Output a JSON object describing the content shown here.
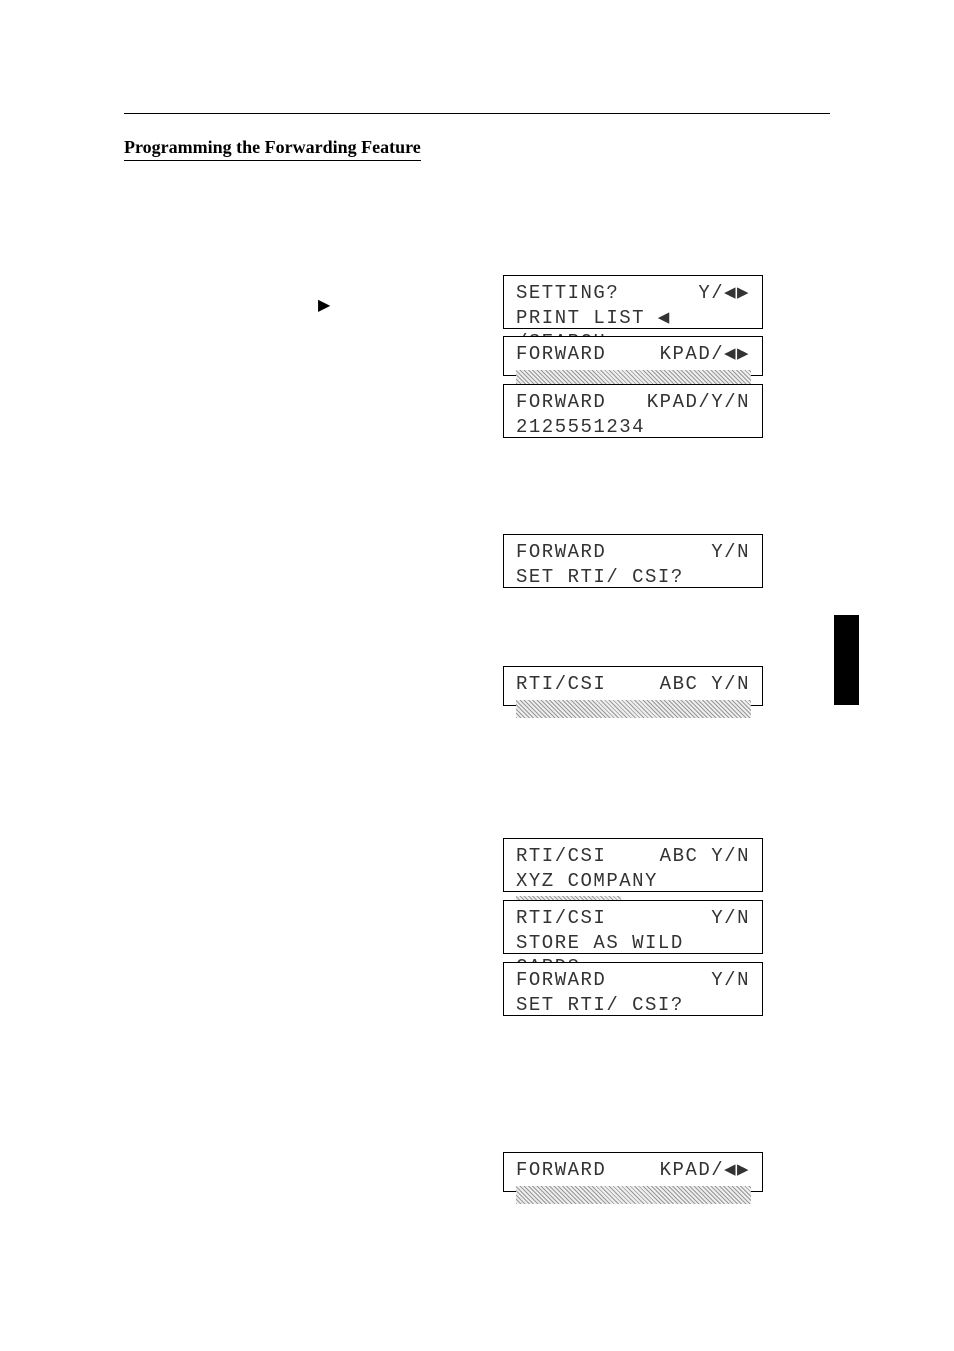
{
  "title": "Programming the Forwarding Feature",
  "displays": {
    "box1": {
      "line1_left": "SETTING?",
      "line1_right": "Y/◀▶",
      "line2": "PRINT LIST ◀ /SEARCH ▶"
    },
    "box2": {
      "line1_left": "FORWARD",
      "line1_right": "KPAD/◀▶"
    },
    "box3": {
      "line1_left": "FORWARD",
      "line1_right": "KPAD/Y/N",
      "line2": "2125551234"
    },
    "box4": {
      "line1_left": "FORWARD",
      "line1_right": "Y/N",
      "line2": "SET RTI/ CSI?"
    },
    "box5": {
      "line1_left": "RTI/CSI",
      "line1_right": "ABC Y/N"
    },
    "box6": {
      "line1_left": "RTI/CSI",
      "line1_right": "ABC Y/N",
      "line2": "XYZ COMPANY"
    },
    "box7": {
      "line1_left": "RTI/CSI",
      "line1_right": "Y/N",
      "line2": "STORE AS WILD CARD?"
    },
    "box8": {
      "line1_left": "FORWARD",
      "line1_right": "Y/N",
      "line2": "SET RTI/ CSI?"
    },
    "box9": {
      "line1_left": "FORWARD",
      "line1_right": "KPAD/◀▶"
    }
  }
}
